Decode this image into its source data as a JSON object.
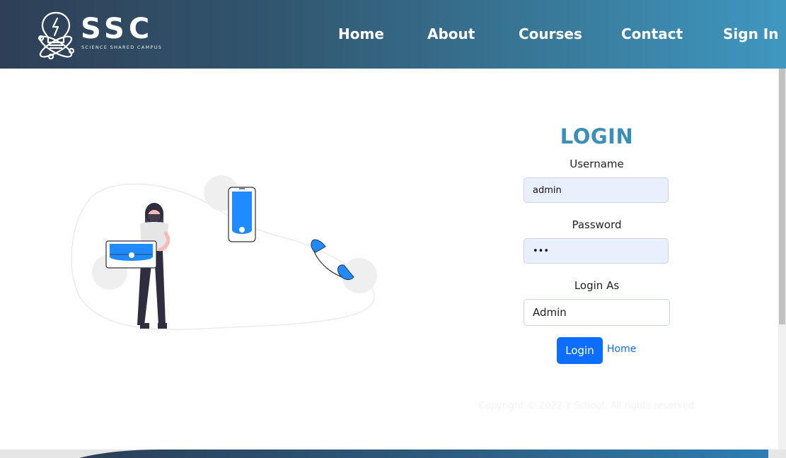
{
  "brand": {
    "name": "SSC",
    "tagline": "SCIENCE SHARED CAMPUS"
  },
  "nav": {
    "items": [
      {
        "label": "Home"
      },
      {
        "label": "About"
      },
      {
        "label": "Courses"
      },
      {
        "label": "Contact"
      },
      {
        "label": "Sign In"
      }
    ]
  },
  "login": {
    "title": "LOGIN",
    "username_label": "Username",
    "username_value": "admin",
    "password_label": "Password",
    "password_value": "•••",
    "role_label": "Login As",
    "role_value": "Admin",
    "submit_label": "Login",
    "home_link": "Home"
  },
  "footer": {
    "copyright": "Copyright © 2022 Y School. All rights reserved."
  },
  "colors": {
    "accent": "#3a8fb9",
    "primary_button": "#0d6efd",
    "header_start": "#2e3f56",
    "header_end": "#3f97c0",
    "input_autofill": "#e8f0fe"
  },
  "icons": {
    "logo": "lightbulb-atom-icon",
    "illustration": "woman-with-laptop-and-phone-illustration"
  }
}
